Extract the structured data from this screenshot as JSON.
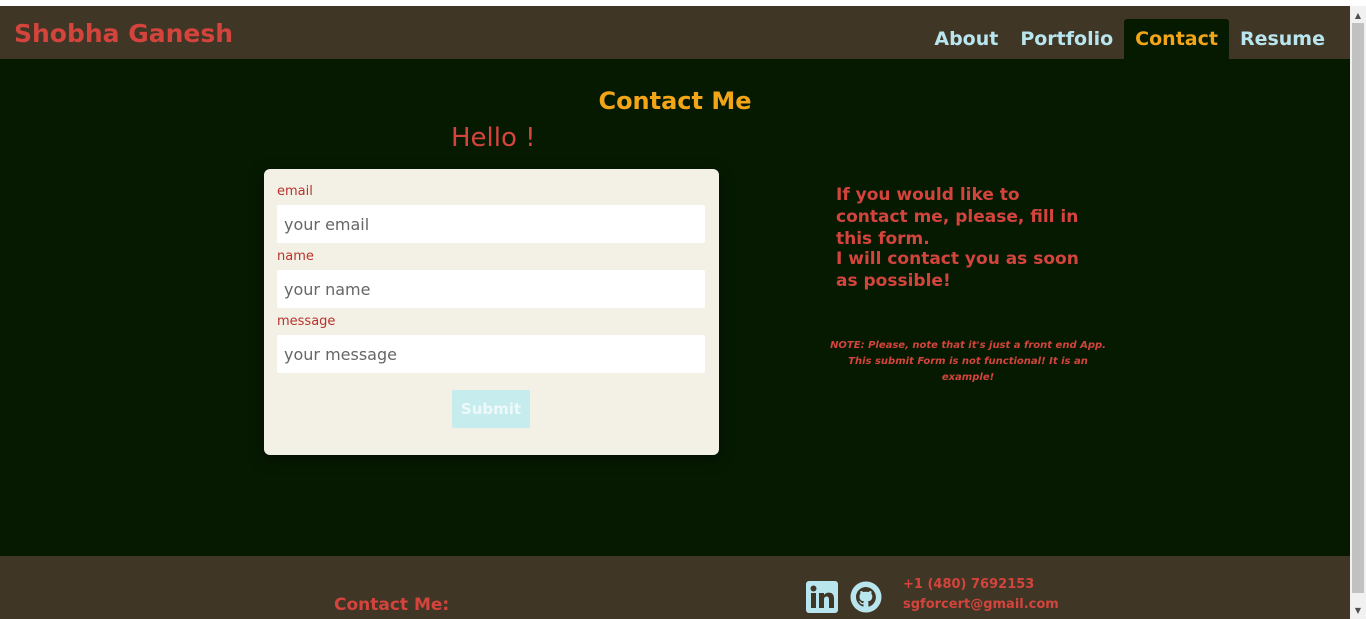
{
  "header": {
    "brand": "Shobha Ganesh",
    "nav": [
      {
        "label": "About"
      },
      {
        "label": "Portfolio"
      },
      {
        "label": "Contact"
      },
      {
        "label": "Resume"
      }
    ],
    "active_nav": "Contact"
  },
  "main": {
    "title": "Contact Me",
    "greeting": "Hello !",
    "form": {
      "email_label": "email",
      "email_placeholder": "your email",
      "email_value": "",
      "name_label": "name",
      "name_placeholder": "your name",
      "name_value": "",
      "message_label": "message",
      "message_placeholder": "your message",
      "message_value": "",
      "submit_label": "Submit"
    },
    "info_line1": "If you would like to contact me, please, fill in this form.",
    "info_line2": "I will contact you as soon as possible!",
    "note": "NOTE: Please, note that it's just a front end App. This submit Form is not functional! It is an example!"
  },
  "footer": {
    "heading": "Contact Me:",
    "phone": "+1 (480) 7692153",
    "email": "sgforcert@gmail.com",
    "social": [
      {
        "icon": "linkedin-icon"
      },
      {
        "icon": "github-icon"
      }
    ]
  },
  "colors": {
    "header_bg": "#3f3626",
    "main_bg": "#061a02",
    "accent_orange": "#f2a516",
    "accent_red": "#d4443c",
    "nav_text": "#b9e6ee",
    "card_bg": "#f3f0e5",
    "submit_bg": "#c6ecee"
  }
}
